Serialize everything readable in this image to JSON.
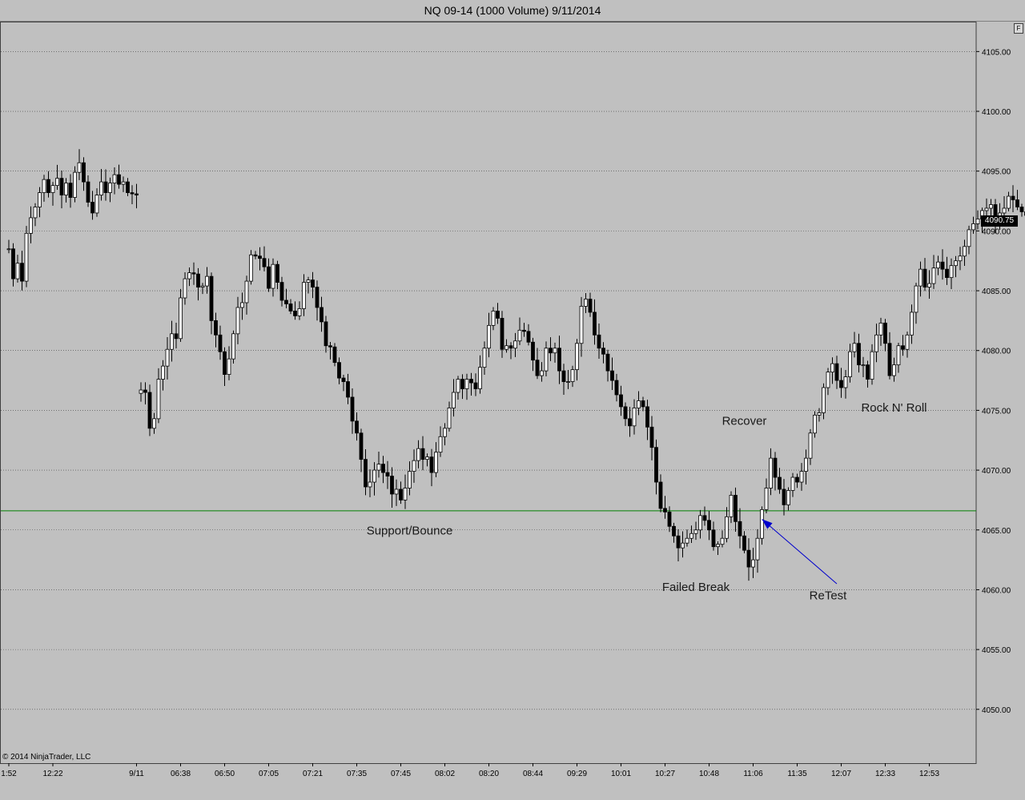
{
  "window": {
    "title": "NQ 09-14 (1000 Volume)  9/11/2014",
    "float_button": "F"
  },
  "copyright": "© 2014 NinjaTrader, LLC",
  "last_price": "4090.75",
  "colors": {
    "background": "#c0c0c0",
    "up_candle": "#ffffff",
    "down_candle": "#000000",
    "support_line": "#008000",
    "arrow": "#0000cc",
    "grid": "#404040"
  },
  "chart_data": {
    "type": "candlestick",
    "title": "NQ 09-14 (1000 Volume)  9/11/2014",
    "ylim": [
      4045.5,
      4107.5
    ],
    "grid": true,
    "y_ticks": [
      "4105.00",
      "4100.00",
      "4095.00",
      "4090.00",
      "4085.00",
      "4080.00",
      "4075.00",
      "4070.00",
      "4065.00",
      "4060.00",
      "4055.00",
      "4050.00"
    ],
    "x_ticks": [
      {
        "label": "1:52",
        "bar": 0
      },
      {
        "label": "12:22",
        "bar": 10
      },
      {
        "label": "9/11",
        "bar": 29
      },
      {
        "label": "06:38",
        "bar": 39
      },
      {
        "label": "06:50",
        "bar": 49
      },
      {
        "label": "07:05",
        "bar": 59
      },
      {
        "label": "07:21",
        "bar": 69
      },
      {
        "label": "07:35",
        "bar": 79
      },
      {
        "label": "07:45",
        "bar": 89
      },
      {
        "label": "08:02",
        "bar": 99
      },
      {
        "label": "08:20",
        "bar": 109
      },
      {
        "label": "08:44",
        "bar": 119
      },
      {
        "label": "09:29",
        "bar": 129
      },
      {
        "label": "10:01",
        "bar": 139
      },
      {
        "label": "10:27",
        "bar": 149
      },
      {
        "label": "10:48",
        "bar": 159
      },
      {
        "label": "11:06",
        "bar": 169
      },
      {
        "label": "11:35",
        "bar": 179
      },
      {
        "label": "12:07",
        "bar": 189
      },
      {
        "label": "12:33",
        "bar": 199
      },
      {
        "label": "12:53",
        "bar": 209
      }
    ],
    "support_level": 4066.6,
    "annotations": [
      {
        "text": "Support/Bounce",
        "bar": 91,
        "price": 4064.6
      },
      {
        "text": "Failed Break",
        "bar": 156,
        "price": 4059.9
      },
      {
        "text": "Recover",
        "bar": 167,
        "price": 4073.8
      },
      {
        "text": "ReTest",
        "bar": 186,
        "price": 4059.2
      },
      {
        "text": "Rock N' Roll",
        "bar": 201,
        "price": 4074.9
      }
    ],
    "arrow": {
      "from": {
        "bar": 188,
        "price": 4060.5
      },
      "to": {
        "bar": 171,
        "price": 4065.9
      }
    },
    "closes": [
      4088.5,
      4086.0,
      4087.3,
      4085.8,
      4089.8,
      4091.1,
      4092.0,
      4093.2,
      4094.3,
      4093.2,
      4093.8,
      4094.4,
      4093.0,
      4094.0,
      4092.8,
      4094.9,
      4095.7,
      4094.1,
      4092.4,
      4091.5,
      4093.0,
      4094.1,
      4093.2,
      4094.0,
      4094.7,
      4093.9,
      4094.1,
      4093.2,
      4093.1,
      4093.0,
      4076.7,
      4076.5,
      4073.5,
      4074.3,
      4077.6,
      4078.7,
      4080.1,
      4081.4,
      4081.0,
      4084.4,
      4086.0,
      4086.5,
      4086.4,
      4085.3,
      4085.4,
      4086.2,
      4082.5,
      4081.3,
      4079.9,
      4078.0,
      4079.3,
      4081.4,
      4083.6,
      4084.0,
      4085.8,
      4088.0,
      4087.9,
      4087.7,
      4087.0,
      4085.2,
      4087.2,
      4085.7,
      4084.2,
      4083.9,
      4083.3,
      4082.9,
      4083.5,
      4085.7,
      4085.9,
      4085.3,
      4083.6,
      4082.4,
      4080.4,
      4080.3,
      4079.0,
      4077.7,
      4077.4,
      4076.1,
      4074.1,
      4073.1,
      4070.9,
      4068.6,
      4069.0,
      4070.0,
      4070.5,
      4069.8,
      4069.5,
      4068.0,
      4068.4,
      4067.5,
      4068.5,
      4069.9,
      4070.8,
      4071.8,
      4070.9,
      4071.1,
      4069.8,
      4071.5,
      4072.8,
      4073.5,
      4075.2,
      4076.5,
      4077.6,
      4076.8,
      4077.6,
      4077.3,
      4076.8,
      4078.6,
      4080.2,
      4082.1,
      4083.3,
      4082.7,
      4080.1,
      4080.4,
      4080.2,
      4080.8,
      4081.7,
      4081.6,
      4080.7,
      4079.2,
      4077.9,
      4078.3,
      4080.2,
      4079.8,
      4080.2,
      4078.3,
      4077.4,
      4077.4,
      4078.4,
      4080.6,
      4083.7,
      4084.3,
      4083.2,
      4081.3,
      4080.2,
      4079.7,
      4078.3,
      4077.5,
      4076.3,
      4075.3,
      4074.3,
      4073.7,
      4075.2,
      4075.8,
      4075.3,
      4073.6,
      4071.9,
      4069.0,
      4066.8,
      4066.5,
      4065.3,
      4064.5,
      4063.5,
      4063.9,
      4064.3,
      4064.7,
      4065.0,
      4066.2,
      4065.8,
      4065.0,
      4063.6,
      4063.8,
      4064.3,
      4066.1,
      4067.9,
      4065.7,
      4064.5,
      4063.3,
      4061.9,
      4062.5,
      4064.3,
      4066.7,
      4068.5,
      4071.0,
      4069.4,
      4068.4,
      4067.1,
      4068.3,
      4069.4,
      4069.0,
      4069.9,
      4071.0,
      4073.1,
      4074.6,
      4074.8,
      4076.9,
      4078.2,
      4078.9,
      4077.5,
      4076.9,
      4077.8,
      4079.9,
      4080.6,
      4078.8,
      4078.8,
      4077.6,
      4079.9,
      4081.3,
      4082.3,
      4080.6,
      4077.9,
      4078.8,
      4080.4,
      4080.1,
      4081.3,
      4083.2,
      4085.4,
      4086.8,
      4085.3,
      4085.6,
      4086.9,
      4087.4,
      4086.8,
      4086.1,
      4087.1,
      4087.5,
      4087.9,
      4088.7,
      4090.1,
      4090.6,
      4091.0,
      4091.7,
      4091.9,
      4092.2,
      4090.7,
      4091.5,
      4091.9,
      4092.9,
      4092.6,
      4092.0,
      4091.6,
      4091.3,
      4091.0,
      4090.8
    ]
  }
}
